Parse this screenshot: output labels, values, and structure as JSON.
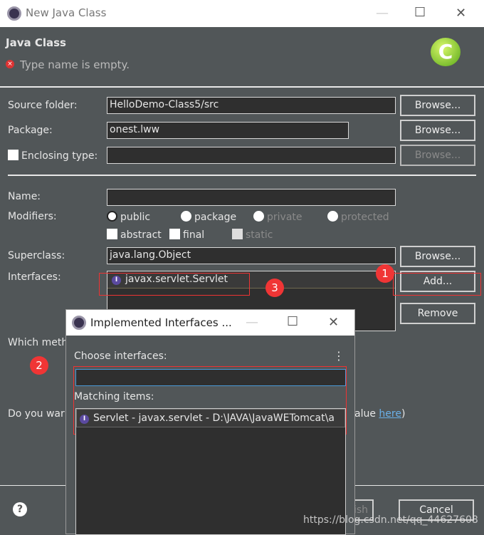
{
  "window": {
    "title": "New Java Class",
    "minimize": "—",
    "maximize": "☐",
    "close": "✕"
  },
  "header": {
    "title": "Java Class",
    "error": "Type name is empty.",
    "banner_icon": "class-c-icon"
  },
  "form": {
    "source_folder_label": "Source folder:",
    "source_folder_value": "HelloDemo-Class5/src",
    "browse1": "Browse...",
    "package_label": "Package:",
    "package_value": "onest.lww",
    "browse2": "Browse...",
    "enclosing_label": "Enclosing type:",
    "enclosing_value": "",
    "browse3": "Browse...",
    "name_label": "Name:",
    "name_value": "",
    "modifiers_label": "Modifiers:",
    "modifiers": [
      "public",
      "package",
      "private",
      "protected"
    ],
    "checks": [
      "abstract",
      "final",
      "static"
    ],
    "superclass_label": "Superclass:",
    "superclass_value": "java.lang.Object",
    "browse4": "Browse...",
    "interfaces_label": "Interfaces:",
    "interfaces": [
      "javax.servlet.Servlet"
    ],
    "add": "Add...",
    "remove": "Remove",
    "which_methods": "Which meth",
    "do_you_want": "Do you war",
    "value_here_prefix": "alue ",
    "here_link": "here",
    "value_here_suffix": ")"
  },
  "footer": {
    "finish": "ish",
    "cancel": "Cancel",
    "help": "?"
  },
  "annotations": [
    "1",
    "2",
    "3"
  ],
  "watermark": "https://blog.csdn.net/qq_44627608",
  "popup": {
    "title": "Implemented Interfaces ...",
    "minimize": "—",
    "maximize": "☐",
    "close": "✕",
    "choose_label": "Choose interfaces:",
    "menu": "⋮",
    "filter_value": "",
    "matching_label": "Matching items:",
    "items": [
      "Servlet - javax.servlet - D:\\JAVA\\JavaWETomcat\\a"
    ]
  }
}
